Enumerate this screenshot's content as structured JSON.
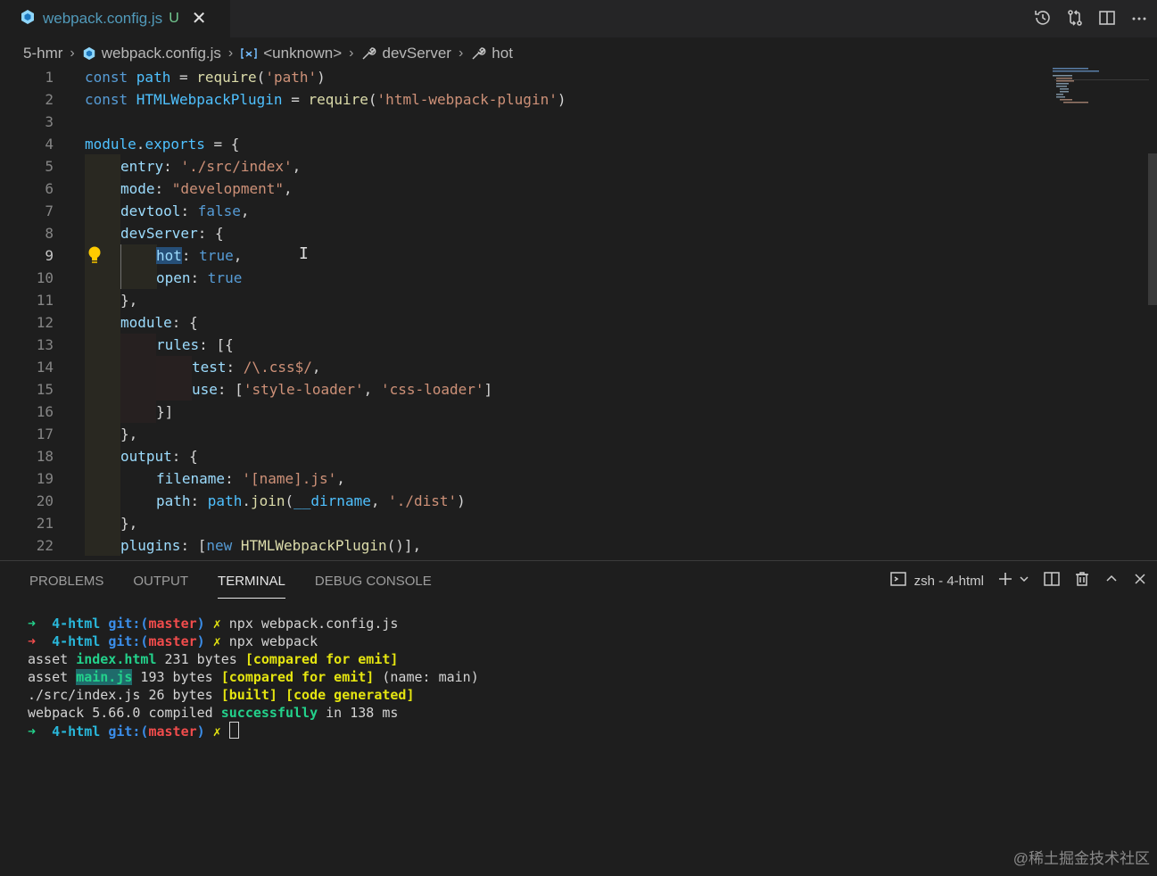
{
  "tab": {
    "label": "webpack.config.js",
    "status": "U",
    "close": "✕"
  },
  "editor_actions": [
    "history-icon",
    "compare-changes-icon",
    "split-editor-icon",
    "more-actions-icon"
  ],
  "breadcrumb": [
    "5-hmr",
    "webpack.config.js",
    "<unknown>",
    "devServer",
    "hot"
  ],
  "code_lines": [
    {
      "n": "1",
      "indent": 0,
      "t": [
        [
          "kw",
          "const "
        ],
        [
          "var",
          "path"
        ],
        [
          "plain",
          " = "
        ],
        [
          "fn",
          "require"
        ],
        [
          "plain",
          "("
        ],
        [
          "str",
          "'path'"
        ],
        [
          "plain",
          ")"
        ]
      ]
    },
    {
      "n": "2",
      "indent": 0,
      "t": [
        [
          "kw",
          "const "
        ],
        [
          "var",
          "HTMLWebpackPlugin"
        ],
        [
          "plain",
          " = "
        ],
        [
          "fn",
          "require"
        ],
        [
          "plain",
          "("
        ],
        [
          "str",
          "'html-webpack-plugin'"
        ],
        [
          "plain",
          ")"
        ]
      ]
    },
    {
      "n": "3",
      "indent": 0,
      "t": []
    },
    {
      "n": "4",
      "indent": 0,
      "t": [
        [
          "var",
          "module"
        ],
        [
          "plain",
          "."
        ],
        [
          "var",
          "exports"
        ],
        [
          "plain",
          " = {"
        ]
      ]
    },
    {
      "n": "5",
      "indent": 1,
      "t": [
        [
          "prop",
          "entry"
        ],
        [
          "plain",
          ": "
        ],
        [
          "str",
          "'./src/index'"
        ],
        [
          "plain",
          ","
        ]
      ]
    },
    {
      "n": "6",
      "indent": 1,
      "t": [
        [
          "prop",
          "mode"
        ],
        [
          "plain",
          ": "
        ],
        [
          "str",
          "\"development\""
        ],
        [
          "plain",
          ","
        ]
      ]
    },
    {
      "n": "7",
      "indent": 1,
      "t": [
        [
          "prop",
          "devtool"
        ],
        [
          "plain",
          ": "
        ],
        [
          "kw",
          "false"
        ],
        [
          "plain",
          ","
        ]
      ]
    },
    {
      "n": "8",
      "indent": 1,
      "t": [
        [
          "prop",
          "devServer"
        ],
        [
          "plain",
          ": {"
        ]
      ]
    },
    {
      "n": "9",
      "indent": 2,
      "t": [
        [
          "sel prop",
          "hot"
        ],
        [
          "plain",
          ": "
        ],
        [
          "kw",
          "true"
        ],
        [
          "plain",
          ","
        ]
      ]
    },
    {
      "n": "10",
      "indent": 2,
      "t": [
        [
          "prop",
          "open"
        ],
        [
          "plain",
          ": "
        ],
        [
          "kw",
          "true"
        ]
      ]
    },
    {
      "n": "11",
      "indent": 1,
      "t": [
        [
          "plain",
          "},"
        ]
      ]
    },
    {
      "n": "12",
      "indent": 1,
      "t": [
        [
          "prop",
          "module"
        ],
        [
          "plain",
          ": {"
        ]
      ]
    },
    {
      "n": "13",
      "indent": 2,
      "t": [
        [
          "prop",
          "rules"
        ],
        [
          "plain",
          ": [{"
        ]
      ]
    },
    {
      "n": "14",
      "indent": 3,
      "t": [
        [
          "prop",
          "test"
        ],
        [
          "plain",
          ": "
        ],
        [
          "str",
          "/\\.css$/"
        ],
        [
          "plain",
          ","
        ]
      ]
    },
    {
      "n": "15",
      "indent": 3,
      "t": [
        [
          "prop",
          "use"
        ],
        [
          "plain",
          ": ["
        ],
        [
          "str",
          "'style-loader'"
        ],
        [
          "plain",
          ", "
        ],
        [
          "str",
          "'css-loader'"
        ],
        [
          "plain",
          "]"
        ]
      ]
    },
    {
      "n": "16",
      "indent": 2,
      "t": [
        [
          "plain",
          "}]"
        ]
      ]
    },
    {
      "n": "17",
      "indent": 1,
      "t": [
        [
          "plain",
          "},"
        ]
      ]
    },
    {
      "n": "18",
      "indent": 1,
      "t": [
        [
          "prop",
          "output"
        ],
        [
          "plain",
          ": {"
        ]
      ]
    },
    {
      "n": "19",
      "indent": 2,
      "t": [
        [
          "prop",
          "filename"
        ],
        [
          "plain",
          ": "
        ],
        [
          "str",
          "'[name].js'"
        ],
        [
          "plain",
          ","
        ]
      ]
    },
    {
      "n": "20",
      "indent": 2,
      "t": [
        [
          "prop",
          "path"
        ],
        [
          "plain",
          ": "
        ],
        [
          "var",
          "path"
        ],
        [
          "plain",
          "."
        ],
        [
          "fn",
          "join"
        ],
        [
          "plain",
          "("
        ],
        [
          "var",
          "__dirname"
        ],
        [
          "plain",
          ", "
        ],
        [
          "str",
          "'./dist'"
        ],
        [
          "plain",
          ")"
        ]
      ]
    },
    {
      "n": "21",
      "indent": 1,
      "t": [
        [
          "plain",
          "},"
        ]
      ]
    },
    {
      "n": "22",
      "indent": 1,
      "t": [
        [
          "prop",
          "plugins"
        ],
        [
          "plain",
          ": ["
        ],
        [
          "kw",
          "new "
        ],
        [
          "fn",
          "HTMLWebpackPlugin"
        ],
        [
          "plain",
          "()],"
        ]
      ]
    }
  ],
  "active_line": "9",
  "panel": {
    "tabs": [
      "PROBLEMS",
      "OUTPUT",
      "TERMINAL",
      "DEBUG CONSOLE"
    ],
    "active_tab": "TERMINAL",
    "terminal_name": "zsh - 4-html"
  },
  "terminal_lines": [
    [
      [
        "t-arrow",
        "➜  "
      ],
      [
        "t-dir",
        "4-html "
      ],
      [
        "t-git",
        "git:("
      ],
      [
        "t-branch",
        "master"
      ],
      [
        "t-git",
        ")"
      ],
      [
        "t-x",
        " ✗ "
      ],
      [
        "plain",
        "npx webpack.config.js"
      ]
    ],
    [
      [
        "t-arrow-red",
        "➜  "
      ],
      [
        "t-dir",
        "4-html "
      ],
      [
        "t-git",
        "git:("
      ],
      [
        "t-branch",
        "master"
      ],
      [
        "t-git",
        ")"
      ],
      [
        "t-x",
        " ✗ "
      ],
      [
        "plain",
        "npx webpack"
      ]
    ],
    [
      [
        "plain",
        "asset "
      ],
      [
        "t-green",
        "index.html"
      ],
      [
        "plain",
        " 231 bytes "
      ],
      [
        "t-yellow",
        "[compared for emit]"
      ]
    ],
    [
      [
        "plain",
        "asset "
      ],
      [
        "t-hl",
        "main.js"
      ],
      [
        "plain",
        " 193 bytes "
      ],
      [
        "t-yellow",
        "[compared for emit]"
      ],
      [
        "plain",
        " (name: main)"
      ]
    ],
    [
      [
        "plain",
        "./src/index.js 26 bytes "
      ],
      [
        "t-yellow",
        "[built] [code generated]"
      ]
    ],
    [
      [
        "plain",
        "webpack 5.66.0 compiled "
      ],
      [
        "t-green",
        "successfully"
      ],
      [
        "plain",
        " in 138 ms"
      ]
    ],
    [
      [
        "t-arrow",
        "➜  "
      ],
      [
        "t-dir",
        "4-html "
      ],
      [
        "t-git",
        "git:("
      ],
      [
        "t-branch",
        "master"
      ],
      [
        "t-git",
        ")"
      ],
      [
        "t-x",
        " ✗ "
      ],
      [
        "cursor",
        ""
      ]
    ]
  ],
  "watermark": "@稀土掘金技术社区"
}
